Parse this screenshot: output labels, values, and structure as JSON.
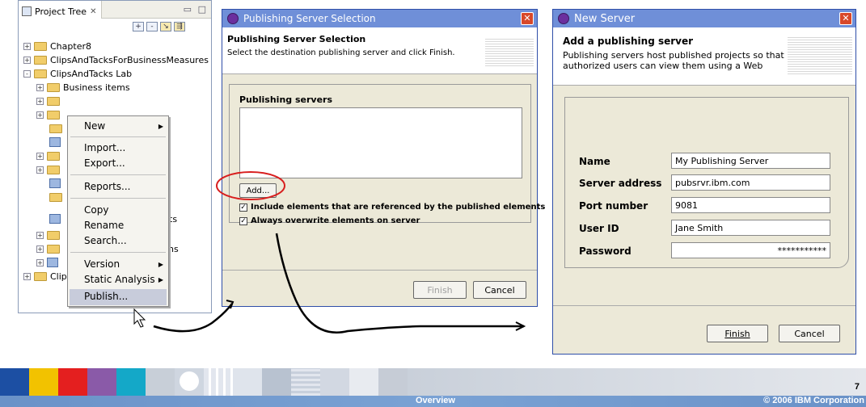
{
  "project_tree": {
    "tab_label": "Project Tree",
    "items": [
      {
        "label": "Chapter8"
      },
      {
        "label": "ClipsAndTacksForBusinessMeasures"
      },
      {
        "label": "ClipsAndTacks Lab"
      },
      {
        "label": "Business items"
      }
    ],
    "partial_labels": [
      "Clip",
      "ts",
      "ns"
    ]
  },
  "context_menu": {
    "items": [
      "New",
      "Import...",
      "Export...",
      "Reports...",
      "Copy",
      "Rename",
      "Search...",
      "Version",
      "Static Analysis",
      "Publish..."
    ],
    "submenu_arrow": "▶"
  },
  "publishing_dialog": {
    "title": "Publishing Server Selection",
    "header_title": "Publishing Server Selection",
    "header_desc": "Select the destination publishing server and click Finish.",
    "section_label": "Publishing servers",
    "add_button": "Add...",
    "check1": "Include elements that are referenced by the published elements",
    "check2": "Always overwrite elements on server",
    "finish_button": "Finish",
    "cancel_button": "Cancel"
  },
  "new_server_dialog": {
    "title": "New Server",
    "header_title": "Add a publishing server",
    "header_desc": "Publishing servers host published projects so that authorized users can view them using a Web",
    "fields": [
      {
        "label": "Name",
        "value": "My Publishing Server"
      },
      {
        "label": "Server address",
        "value": "pubsrvr.ibm.com"
      },
      {
        "label": "Port number",
        "value": "9081"
      },
      {
        "label": "User ID",
        "value": "Jane Smith"
      },
      {
        "label": "Password",
        "value": "***********"
      }
    ],
    "finish_button": "Finish",
    "cancel_button": "Cancel"
  },
  "footer": {
    "page_number": "7",
    "section": "Overview",
    "copyright": "© 2006 IBM Corporation"
  },
  "colors": {
    "annotation_red": "#d81e1e",
    "titlebar": "#6f8fd8"
  }
}
